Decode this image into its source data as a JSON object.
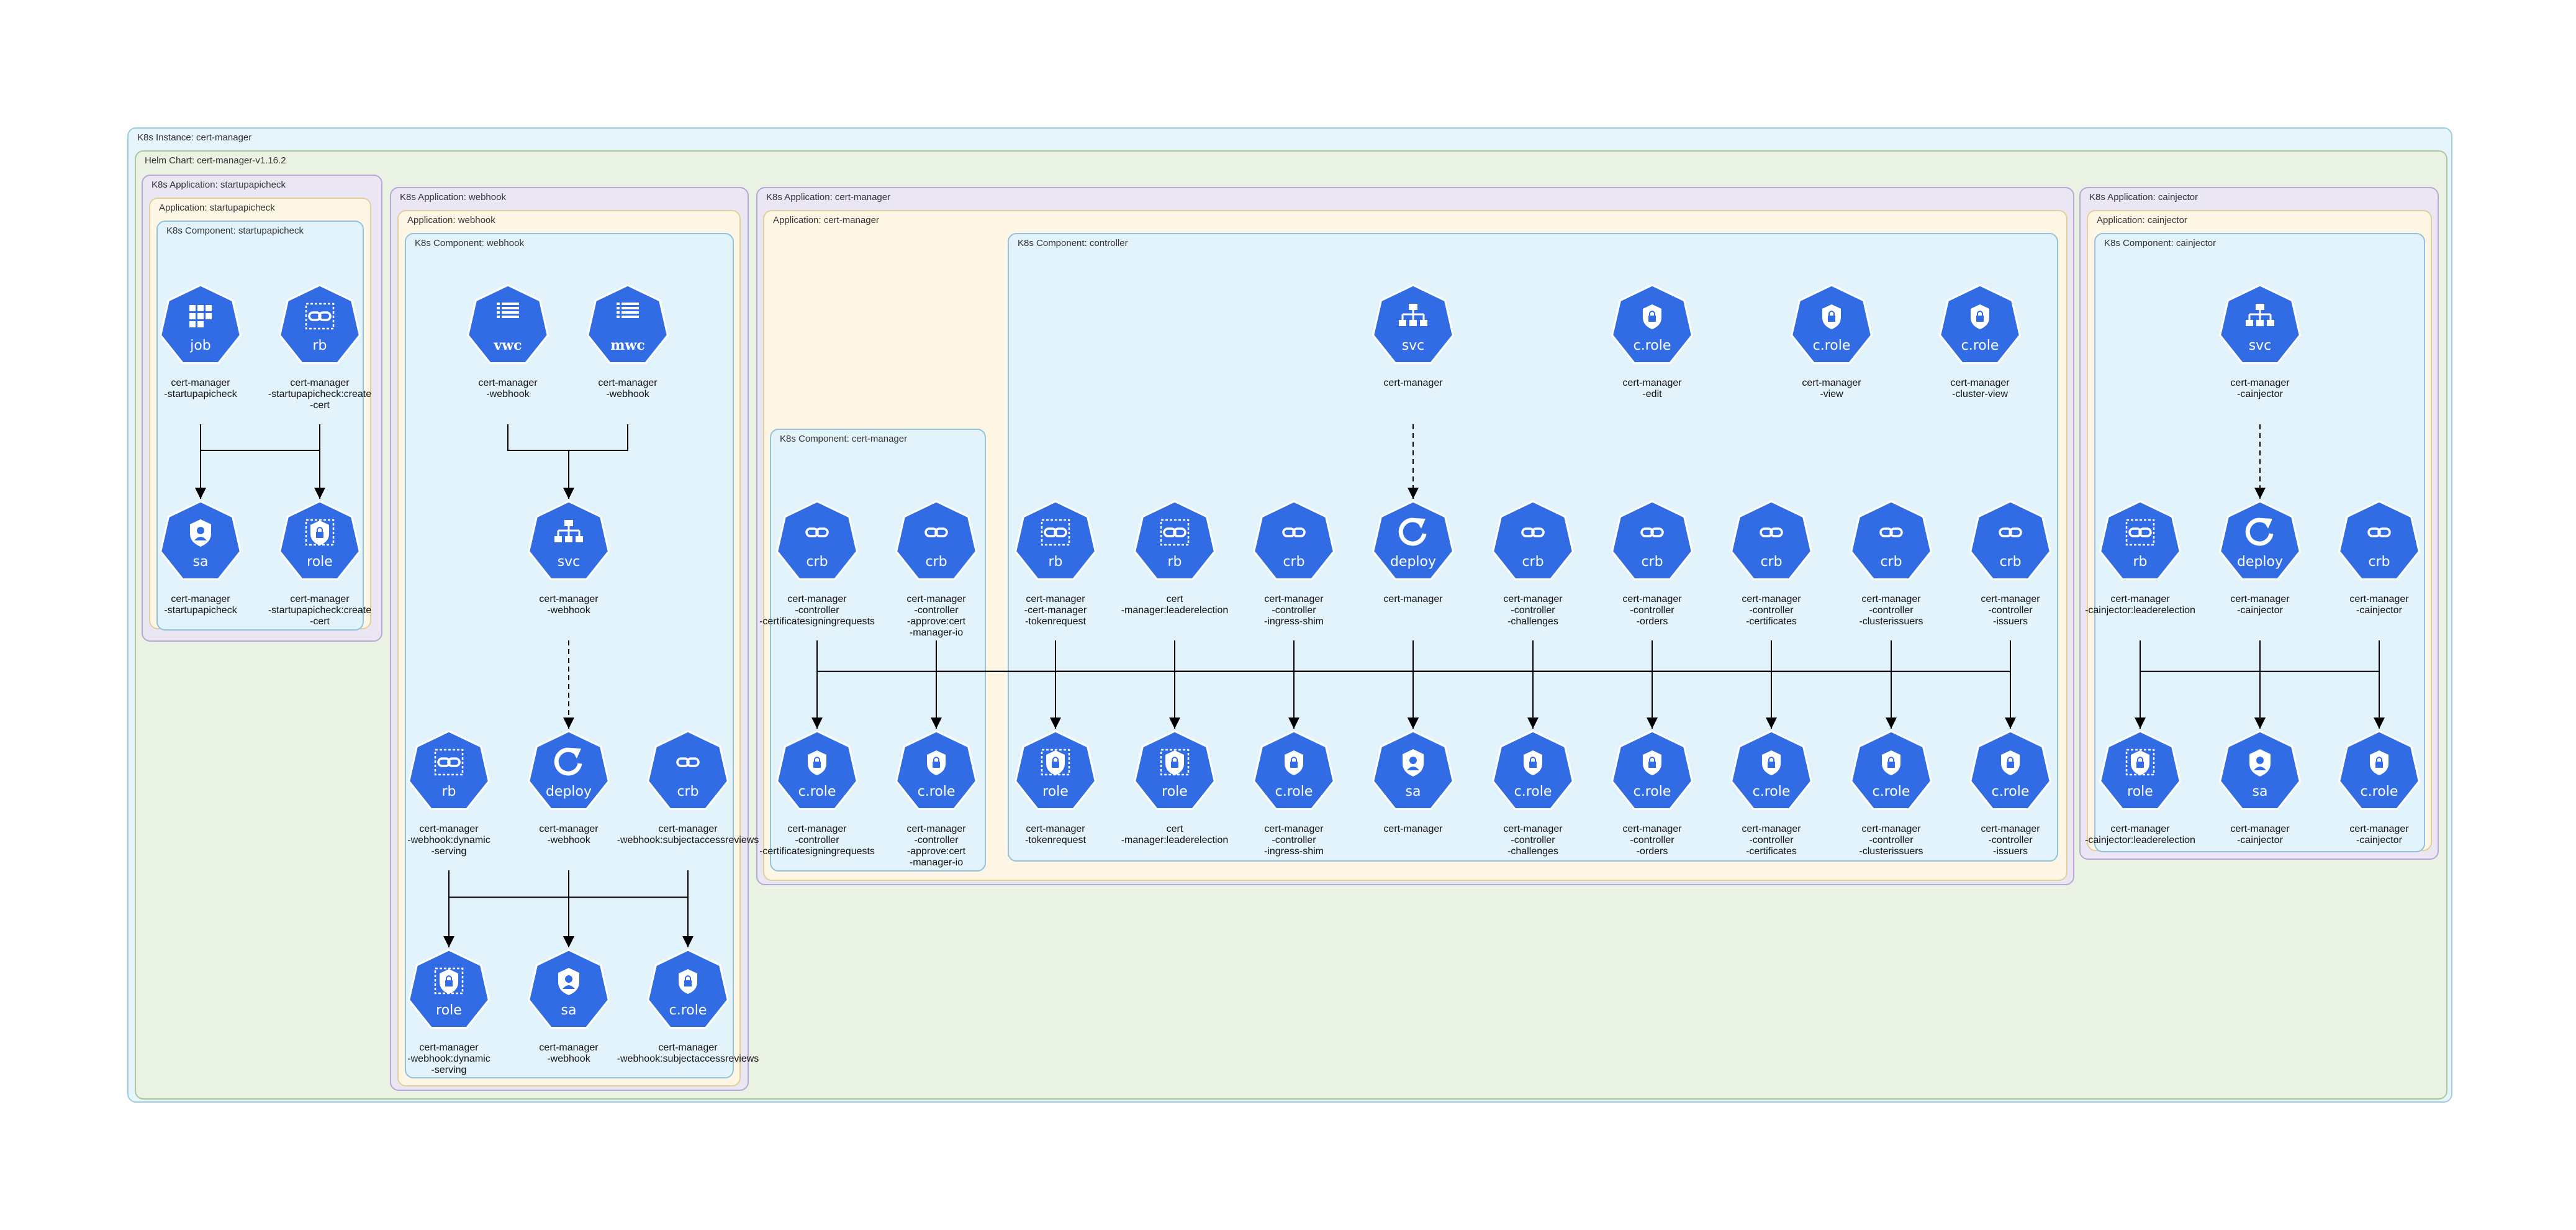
{
  "colors": {
    "node_fill": "#326ce5",
    "node_stroke": "#ffffff",
    "edge": "#000000"
  },
  "clusters": [
    {
      "id": "inst",
      "label": "K8s Instance: cert-manager",
      "level": "instance"
    },
    {
      "id": "chart",
      "label": "Helm Chart: cert-manager-v1.16.2",
      "level": "chart"
    },
    {
      "id": "app_spc",
      "label": "K8s Application: startupapicheck",
      "level": "k8sapp"
    },
    {
      "id": "appl_spc",
      "label": "Application: startupapicheck",
      "level": "app"
    },
    {
      "id": "comp_spc",
      "label": "K8s Component: startupapicheck",
      "level": "comp"
    },
    {
      "id": "app_wh",
      "label": "K8s Application: webhook",
      "level": "k8sapp"
    },
    {
      "id": "appl_wh",
      "label": "Application: webhook",
      "level": "app"
    },
    {
      "id": "comp_wh",
      "label": "K8s Component: webhook",
      "level": "comp"
    },
    {
      "id": "app_cm",
      "label": "K8s Application: cert-manager",
      "level": "k8sapp"
    },
    {
      "id": "appl_cm",
      "label": "Application: cert-manager",
      "level": "app"
    },
    {
      "id": "comp_cm",
      "label": "K8s Component: cert-manager",
      "level": "comp"
    },
    {
      "id": "comp_ctrl",
      "label": "K8s Component: controller",
      "level": "comp"
    },
    {
      "id": "app_ci",
      "label": "K8s Application: cainjector",
      "level": "k8sapp"
    },
    {
      "id": "appl_ci",
      "label": "Application: cainjector",
      "level": "app"
    },
    {
      "id": "comp_ci",
      "label": "K8s Component: cainjector",
      "level": "comp"
    }
  ],
  "nodes": [
    {
      "id": "spc_job",
      "kind": "job",
      "icon": "job-icon",
      "lines": [
        "cert-manager",
        "-startupapicheck"
      ]
    },
    {
      "id": "spc_rb",
      "kind": "rb",
      "icon": "rolebinding-icon",
      "lines": [
        "cert-manager",
        "-startupapicheck:create",
        "-cert"
      ]
    },
    {
      "id": "spc_sa",
      "kind": "sa",
      "icon": "serviceaccount-icon",
      "lines": [
        "cert-manager",
        "-startupapicheck"
      ]
    },
    {
      "id": "spc_role",
      "kind": "role",
      "icon": "role-icon",
      "lines": [
        "cert-manager",
        "-startupapicheck:create",
        "-cert"
      ]
    },
    {
      "id": "wh_vwc",
      "kind": "vwc",
      "icon": "validating-webhook-icon",
      "lines": [
        "cert-manager",
        "-webhook"
      ]
    },
    {
      "id": "wh_mwc",
      "kind": "mwc",
      "icon": "mutating-webhook-icon",
      "lines": [
        "cert-manager",
        "-webhook"
      ]
    },
    {
      "id": "wh_svc",
      "kind": "svc",
      "icon": "service-icon",
      "lines": [
        "cert-manager",
        "-webhook"
      ]
    },
    {
      "id": "wh_rb",
      "kind": "rb",
      "icon": "rolebinding-icon",
      "lines": [
        "cert-manager",
        "-webhook:dynamic",
        "-serving"
      ]
    },
    {
      "id": "wh_deploy",
      "kind": "deploy",
      "icon": "deployment-icon",
      "lines": [
        "cert-manager",
        "-webhook"
      ]
    },
    {
      "id": "wh_crb",
      "kind": "crb",
      "icon": "clusterrolebinding-icon",
      "lines": [
        "cert-manager",
        "-webhook:subjectaccessreviews"
      ]
    },
    {
      "id": "wh_role",
      "kind": "role",
      "icon": "role-icon",
      "lines": [
        "cert-manager",
        "-webhook:dynamic",
        "-serving"
      ]
    },
    {
      "id": "wh_sa",
      "kind": "sa",
      "icon": "serviceaccount-icon",
      "lines": [
        "cert-manager",
        "-webhook"
      ]
    },
    {
      "id": "wh_crole",
      "kind": "c.role",
      "icon": "clusterrole-icon",
      "lines": [
        "cert-manager",
        "-webhook:subjectaccessreviews"
      ]
    },
    {
      "id": "cm_crb1",
      "kind": "crb",
      "icon": "clusterrolebinding-icon",
      "lines": [
        "cert-manager",
        "-controller",
        "-certificatesigningrequests"
      ]
    },
    {
      "id": "cm_crb2",
      "kind": "crb",
      "icon": "clusterrolebinding-icon",
      "lines": [
        "cert-manager",
        "-controller",
        "-approve:cert",
        "-manager-io"
      ]
    },
    {
      "id": "cm_crole1",
      "kind": "c.role",
      "icon": "clusterrole-icon",
      "lines": [
        "cert-manager",
        "-controller",
        "-certificatesigningrequests"
      ]
    },
    {
      "id": "cm_crole2",
      "kind": "c.role",
      "icon": "clusterrole-icon",
      "lines": [
        "cert-manager",
        "-controller",
        "-approve:cert",
        "-manager-io"
      ]
    },
    {
      "id": "ct_svc",
      "kind": "svc",
      "icon": "service-icon",
      "lines": [
        "cert-manager"
      ]
    },
    {
      "id": "ct_crole_edit",
      "kind": "c.role",
      "icon": "clusterrole-icon",
      "lines": [
        "cert-manager",
        "-edit"
      ]
    },
    {
      "id": "ct_crole_view",
      "kind": "c.role",
      "icon": "clusterrole-icon",
      "lines": [
        "cert-manager",
        "-view"
      ]
    },
    {
      "id": "ct_crole_cview",
      "kind": "c.role",
      "icon": "clusterrole-icon",
      "lines": [
        "cert-manager",
        "-cluster-view"
      ]
    },
    {
      "id": "ct_rb1",
      "kind": "rb",
      "icon": "rolebinding-icon",
      "lines": [
        "cert-manager",
        "-cert-manager",
        "-tokenrequest"
      ]
    },
    {
      "id": "ct_rb2",
      "kind": "rb",
      "icon": "rolebinding-icon",
      "lines": [
        "cert",
        "-manager:leaderelection"
      ]
    },
    {
      "id": "ct_crb_is",
      "kind": "crb",
      "icon": "clusterrolebinding-icon",
      "lines": [
        "cert-manager",
        "-controller",
        "-ingress-shim"
      ]
    },
    {
      "id": "ct_deploy",
      "kind": "deploy",
      "icon": "deployment-icon",
      "lines": [
        "cert-manager"
      ]
    },
    {
      "id": "ct_crb_ch",
      "kind": "crb",
      "icon": "clusterrolebinding-icon",
      "lines": [
        "cert-manager",
        "-controller",
        "-challenges"
      ]
    },
    {
      "id": "ct_crb_or",
      "kind": "crb",
      "icon": "clusterrolebinding-icon",
      "lines": [
        "cert-manager",
        "-controller",
        "-orders"
      ]
    },
    {
      "id": "ct_crb_ce",
      "kind": "crb",
      "icon": "clusterrolebinding-icon",
      "lines": [
        "cert-manager",
        "-controller",
        "-certificates"
      ]
    },
    {
      "id": "ct_crb_ci",
      "kind": "crb",
      "icon": "clusterrolebinding-icon",
      "lines": [
        "cert-manager",
        "-controller",
        "-clusterissuers"
      ]
    },
    {
      "id": "ct_crb_iss",
      "kind": "crb",
      "icon": "clusterrolebinding-icon",
      "lines": [
        "cert-manager",
        "-controller",
        "-issuers"
      ]
    },
    {
      "id": "ct_role1",
      "kind": "role",
      "icon": "role-icon",
      "lines": [
        "cert-manager",
        "-tokenrequest"
      ]
    },
    {
      "id": "ct_role2",
      "kind": "role",
      "icon": "role-icon",
      "lines": [
        "cert",
        "-manager:leaderelection"
      ]
    },
    {
      "id": "ct_crole_is",
      "kind": "c.role",
      "icon": "clusterrole-icon",
      "lines": [
        "cert-manager",
        "-controller",
        "-ingress-shim"
      ]
    },
    {
      "id": "ct_sa",
      "kind": "sa",
      "icon": "serviceaccount-icon",
      "lines": [
        "cert-manager"
      ]
    },
    {
      "id": "ct_crole_ch",
      "kind": "c.role",
      "icon": "clusterrole-icon",
      "lines": [
        "cert-manager",
        "-controller",
        "-challenges"
      ]
    },
    {
      "id": "ct_crole_or",
      "kind": "c.role",
      "icon": "clusterrole-icon",
      "lines": [
        "cert-manager",
        "-controller",
        "-orders"
      ]
    },
    {
      "id": "ct_crole_ce",
      "kind": "c.role",
      "icon": "clusterrole-icon",
      "lines": [
        "cert-manager",
        "-controller",
        "-certificates"
      ]
    },
    {
      "id": "ct_crole_ci",
      "kind": "c.role",
      "icon": "clusterrole-icon",
      "lines": [
        "cert-manager",
        "-controller",
        "-clusterissuers"
      ]
    },
    {
      "id": "ct_crole_iss",
      "kind": "c.role",
      "icon": "clusterrole-icon",
      "lines": [
        "cert-manager",
        "-controller",
        "-issuers"
      ]
    },
    {
      "id": "ci_svc",
      "kind": "svc",
      "icon": "service-icon",
      "lines": [
        "cert-manager",
        "-cainjector"
      ]
    },
    {
      "id": "ci_rb",
      "kind": "rb",
      "icon": "rolebinding-icon",
      "lines": [
        "cert-manager",
        "-cainjector:leaderelection"
      ]
    },
    {
      "id": "ci_deploy",
      "kind": "deploy",
      "icon": "deployment-icon",
      "lines": [
        "cert-manager",
        "-cainjector"
      ]
    },
    {
      "id": "ci_crb",
      "kind": "crb",
      "icon": "clusterrolebinding-icon",
      "lines": [
        "cert-manager",
        "-cainjector"
      ]
    },
    {
      "id": "ci_role",
      "kind": "role",
      "icon": "role-icon",
      "lines": [
        "cert-manager",
        "-cainjector:leaderelection"
      ]
    },
    {
      "id": "ci_sa",
      "kind": "sa",
      "icon": "serviceaccount-icon",
      "lines": [
        "cert-manager",
        "-cainjector"
      ]
    },
    {
      "id": "ci_crole",
      "kind": "c.role",
      "icon": "clusterrole-icon",
      "lines": [
        "cert-manager",
        "-cainjector"
      ]
    }
  ],
  "edges": [
    {
      "from": "spc_job",
      "to": "spc_sa",
      "style": "solid"
    },
    {
      "from": "spc_rb",
      "to": "spc_sa",
      "style": "solid"
    },
    {
      "from": "spc_rb",
      "to": "spc_role",
      "style": "solid"
    },
    {
      "from": "wh_vwc",
      "to": "wh_svc",
      "style": "solid"
    },
    {
      "from": "wh_mwc",
      "to": "wh_svc",
      "style": "solid"
    },
    {
      "from": "wh_svc",
      "to": "wh_deploy",
      "style": "dashed"
    },
    {
      "from": "wh_rb",
      "to": "wh_role",
      "style": "solid"
    },
    {
      "from": "wh_rb",
      "to": "wh_sa",
      "style": "solid"
    },
    {
      "from": "wh_deploy",
      "to": "wh_sa",
      "style": "solid"
    },
    {
      "from": "wh_crb",
      "to": "wh_sa",
      "style": "solid"
    },
    {
      "from": "wh_crb",
      "to": "wh_crole",
      "style": "solid"
    },
    {
      "from": "cm_crb1",
      "to": "cm_crole1",
      "style": "solid"
    },
    {
      "from": "cm_crb2",
      "to": "cm_crole2",
      "style": "solid"
    },
    {
      "from": "cm_crb1",
      "to": "ct_sa",
      "style": "solid"
    },
    {
      "from": "cm_crb2",
      "to": "ct_sa",
      "style": "solid"
    },
    {
      "from": "ct_svc",
      "to": "ct_deploy",
      "style": "dashed"
    },
    {
      "from": "ct_rb1",
      "to": "ct_role1",
      "style": "solid"
    },
    {
      "from": "ct_rb1",
      "to": "ct_sa",
      "style": "solid"
    },
    {
      "from": "ct_rb2",
      "to": "ct_role2",
      "style": "solid"
    },
    {
      "from": "ct_rb2",
      "to": "ct_sa",
      "style": "solid"
    },
    {
      "from": "ct_crb_is",
      "to": "ct_crole_is",
      "style": "solid"
    },
    {
      "from": "ct_crb_is",
      "to": "ct_sa",
      "style": "solid"
    },
    {
      "from": "ct_deploy",
      "to": "ct_sa",
      "style": "solid"
    },
    {
      "from": "ct_crb_ch",
      "to": "ct_crole_ch",
      "style": "solid"
    },
    {
      "from": "ct_crb_ch",
      "to": "ct_sa",
      "style": "solid"
    },
    {
      "from": "ct_crb_or",
      "to": "ct_crole_or",
      "style": "solid"
    },
    {
      "from": "ct_crb_or",
      "to": "ct_sa",
      "style": "solid"
    },
    {
      "from": "ct_crb_ce",
      "to": "ct_crole_ce",
      "style": "solid"
    },
    {
      "from": "ct_crb_ce",
      "to": "ct_sa",
      "style": "solid"
    },
    {
      "from": "ct_crb_ci",
      "to": "ct_crole_ci",
      "style": "solid"
    },
    {
      "from": "ct_crb_ci",
      "to": "ct_sa",
      "style": "solid"
    },
    {
      "from": "ct_crb_iss",
      "to": "ct_crole_iss",
      "style": "solid"
    },
    {
      "from": "ct_crb_iss",
      "to": "ct_sa",
      "style": "solid"
    },
    {
      "from": "ci_svc",
      "to": "ci_deploy",
      "style": "dashed"
    },
    {
      "from": "ci_rb",
      "to": "ci_role",
      "style": "solid"
    },
    {
      "from": "ci_rb",
      "to": "ci_sa",
      "style": "solid"
    },
    {
      "from": "ci_deploy",
      "to": "ci_sa",
      "style": "solid"
    },
    {
      "from": "ci_crb",
      "to": "ci_sa",
      "style": "solid"
    },
    {
      "from": "ci_crb",
      "to": "ci_crole",
      "style": "solid"
    }
  ]
}
